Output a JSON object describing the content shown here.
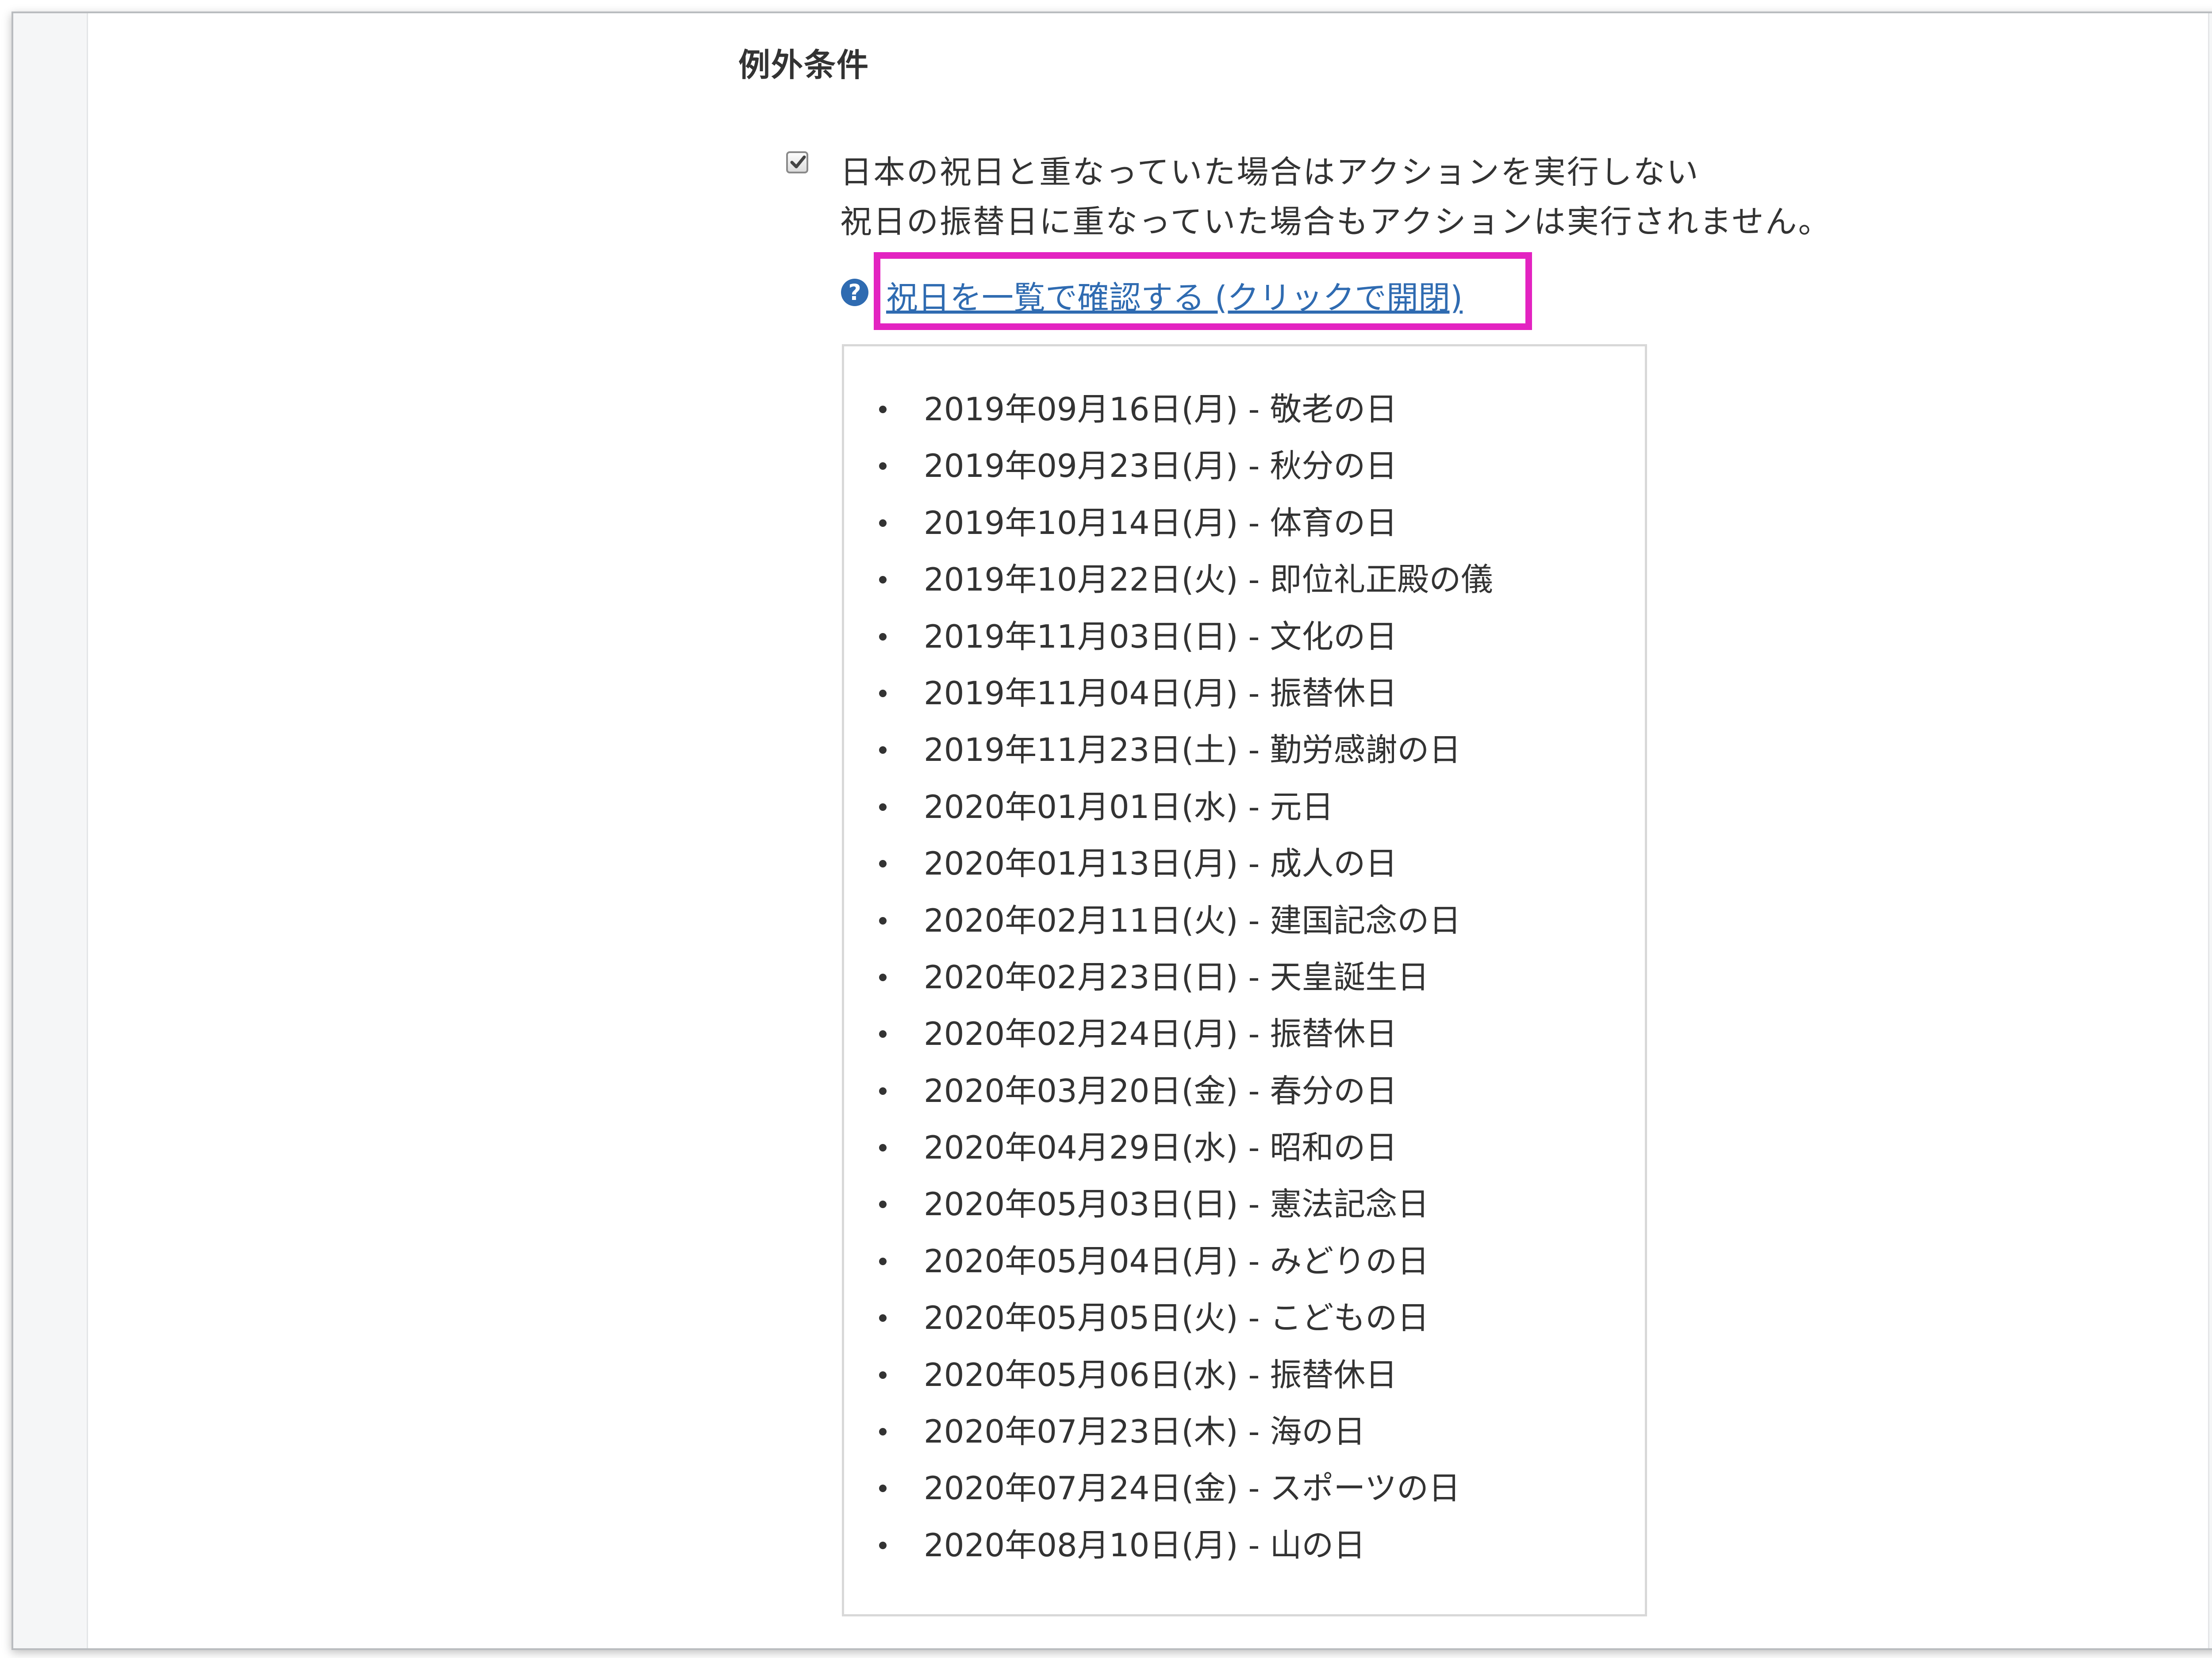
{
  "section": {
    "title": "例外条件"
  },
  "option": {
    "checked": true,
    "label": "日本の祝日と重なっていた場合はアクションを実行しない",
    "note": "祝日の振替日に重なっていた場合もアクションは実行されません。"
  },
  "toggle": {
    "icon": "question-circle-icon",
    "label": "祝日を一覧で確認する (クリックで開閉)",
    "highlight_color": "#e323c1",
    "link_color": "#2f6bb1"
  },
  "holidays": [
    "2019年09月16日(月) - 敬老の日",
    "2019年09月23日(月) - 秋分の日",
    "2019年10月14日(月) - 体育の日",
    "2019年10月22日(火) - 即位礼正殿の儀",
    "2019年11月03日(日) - 文化の日",
    "2019年11月04日(月) - 振替休日",
    "2019年11月23日(土) - 勤労感謝の日",
    "2020年01月01日(水) - 元日",
    "2020年01月13日(月) - 成人の日",
    "2020年02月11日(火) - 建国記念の日",
    "2020年02月23日(日) - 天皇誕生日",
    "2020年02月24日(月) - 振替休日",
    "2020年03月20日(金) - 春分の日",
    "2020年04月29日(水) - 昭和の日",
    "2020年05月03日(日) - 憲法記念日",
    "2020年05月04日(月) - みどりの日",
    "2020年05月05日(火) - こどもの日",
    "2020年05月06日(水) - 振替休日",
    "2020年07月23日(木) - 海の日",
    "2020年07月24日(金) - スポーツの日",
    "2020年08月10日(月) - 山の日"
  ]
}
